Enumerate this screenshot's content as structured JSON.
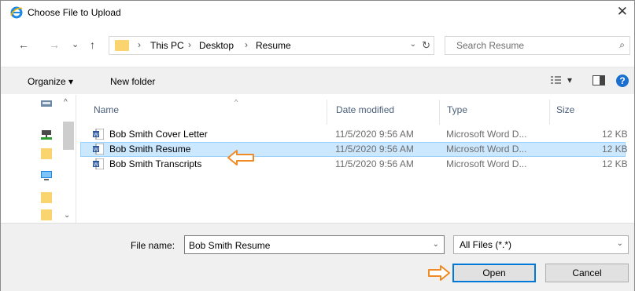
{
  "window": {
    "title": "Choose File to Upload",
    "close_glyph": "✕"
  },
  "nav_buttons": {
    "back": "←",
    "forward": "→",
    "recent": "⌄",
    "up": "↑"
  },
  "address": {
    "breadcrumbs": [
      "This PC",
      "Desktop",
      "Resume"
    ],
    "separator": "›",
    "dropdown": "⌄",
    "refresh": "↻"
  },
  "search": {
    "placeholder": "Search Resume",
    "icon": "⌕"
  },
  "toolbar": {
    "organize_label": "Organize ▾",
    "new_folder_label": "New folder",
    "view_dropdown": "▾",
    "help": "?"
  },
  "columns": {
    "name": "Name",
    "date": "Date modified",
    "type": "Type",
    "size": "Size",
    "sort_caret": "^"
  },
  "files": [
    {
      "name": "Bob Smith Cover Letter",
      "date": "11/5/2020 9:56 AM",
      "type": "Microsoft Word D...",
      "size": "12 KB",
      "selected": false
    },
    {
      "name": "Bob Smith Resume",
      "date": "11/5/2020 9:56 AM",
      "type": "Microsoft Word D...",
      "size": "12 KB",
      "selected": true
    },
    {
      "name": "Bob Smith Transcripts",
      "date": "11/5/2020 9:56 AM",
      "type": "Microsoft Word D...",
      "size": "12 KB",
      "selected": false
    }
  ],
  "bottom": {
    "file_name_label": "File name:",
    "file_name_value": "Bob Smith Resume",
    "filter_value": "All Files (*.*)",
    "dropdown": "⌄",
    "open_label": "Open",
    "cancel_label": "Cancel"
  },
  "colors": {
    "accent": "#0078d7",
    "selection": "#cce8ff",
    "annotation_arrow": "#f08a24"
  }
}
